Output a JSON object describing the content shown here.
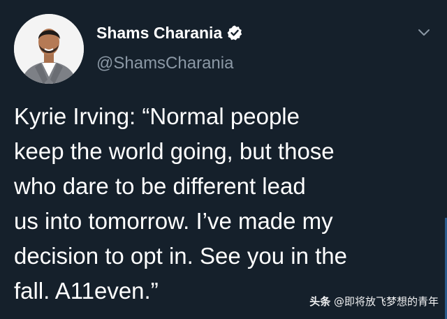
{
  "tweet": {
    "author": {
      "display_name": "Shams Charania",
      "handle": "@ShamsCharania",
      "verified": true,
      "verified_color": "#ffffff"
    },
    "text": "Kyrie Irving: “Normal people\nkeep the world going, but those\nwho dare to be different lead\nus into tomorrow. I’ve made my\ndecision to opt in. See you in the\nfall. A11even.”",
    "menu_icon": "chevron-down-icon"
  },
  "watermark": {
    "brand": "头条",
    "account": " @即将放飞梦想的青年"
  },
  "colors": {
    "background": "#15202b",
    "primary_text": "#ffffff",
    "secondary_text": "#8b98a5"
  }
}
